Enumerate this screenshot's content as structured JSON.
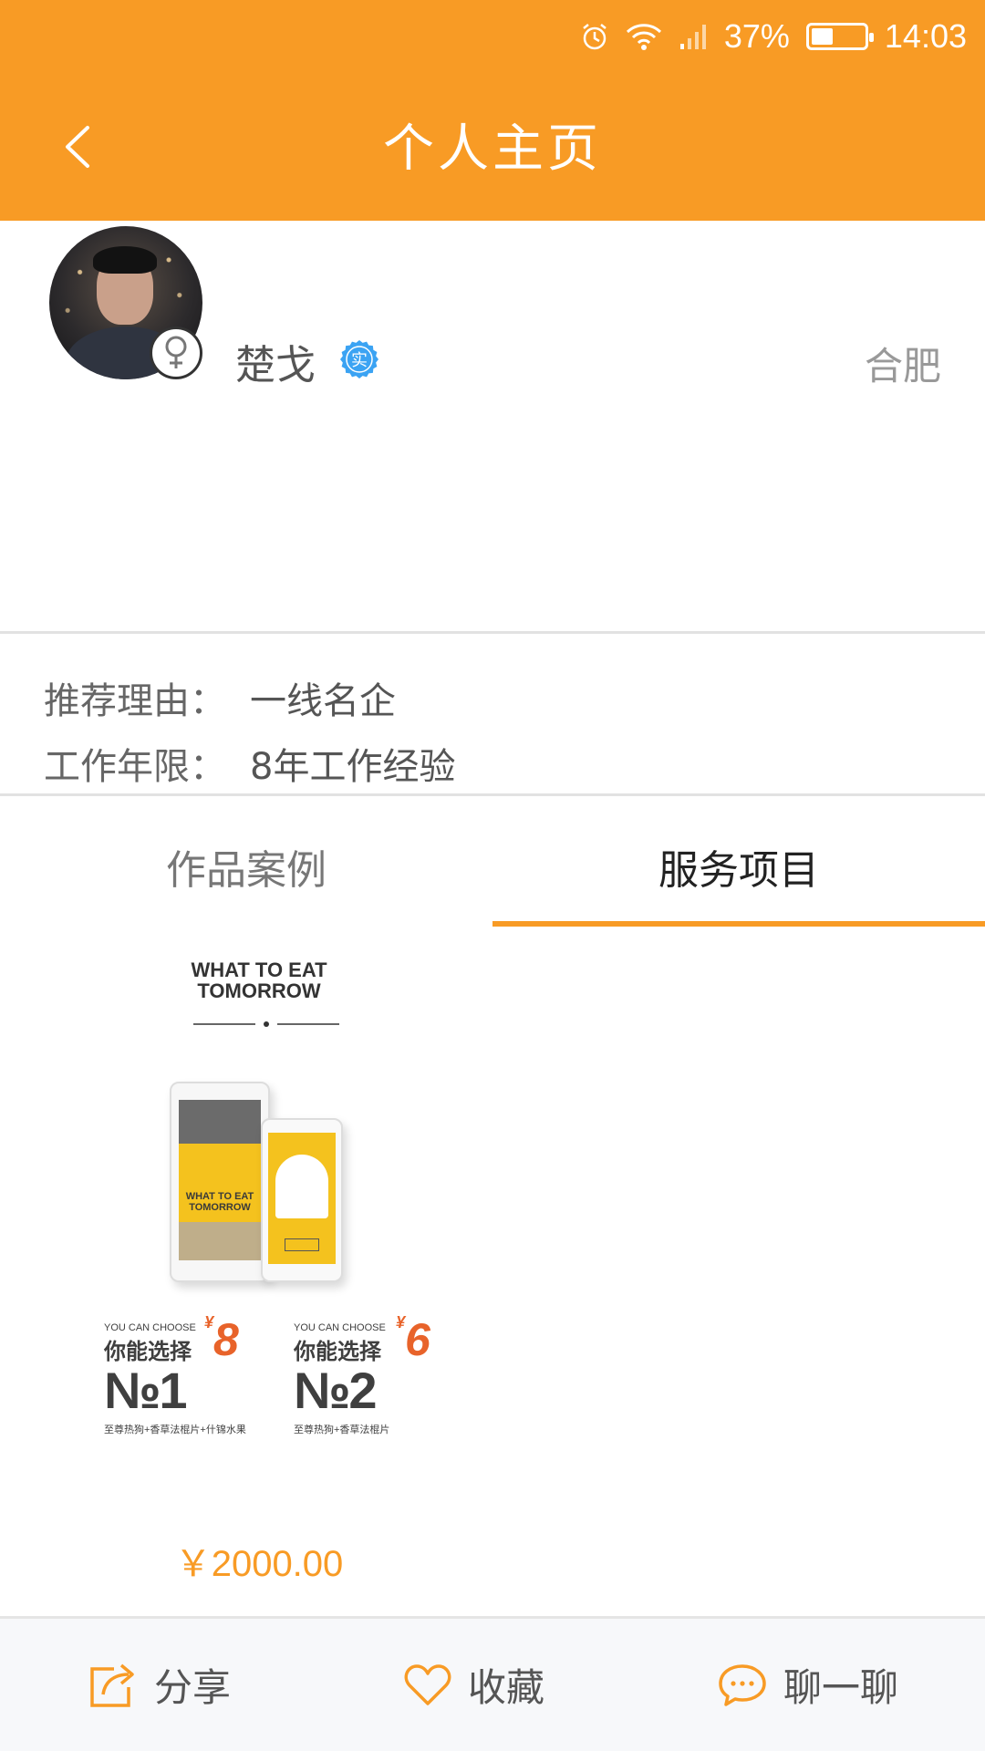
{
  "status_bar": {
    "battery_percent": "37%",
    "battery_level": 0.37,
    "time": "14:03",
    "icons": [
      "alarm-icon",
      "wifi-icon",
      "signal-icon",
      "battery-icon"
    ]
  },
  "header": {
    "title": "个人主页",
    "back_icon": "chevron-left-icon"
  },
  "profile": {
    "name": "楚戈",
    "city": "合肥",
    "gender_icon": "female-symbol-icon",
    "verified_badge_text": "实",
    "verified_badge_color": "#3BA3F3"
  },
  "info": {
    "reason_label": "推荐理由：",
    "reason_value": "一线名企",
    "years_label": "工作年限：",
    "years_value": "8年工作经验"
  },
  "tabs": [
    {
      "label": "作品案例",
      "active": false
    },
    {
      "label": "服务项目",
      "active": true
    }
  ],
  "product": {
    "poster": {
      "title_line1": "WHAT TO EAT",
      "title_line2": "TOMORROW",
      "tablet_title": "WHAT TO EAT TOMORROW",
      "choice1": {
        "small": "YOU CAN CHOOSE",
        "cn": "你能选择",
        "num": "№1",
        "price": "8",
        "yen": "¥",
        "desc": "至尊热狗+香草法棍片+什锦水果"
      },
      "choice2": {
        "small": "YOU CAN CHOOSE",
        "cn": "你能选择",
        "num": "№2",
        "price": "6",
        "yen": "¥",
        "desc": "至尊热狗+香草法棍片"
      }
    },
    "price": "￥2000.00"
  },
  "bottom_bar": {
    "share": "分享",
    "favorite": "收藏",
    "chat": "聊一聊"
  },
  "colors": {
    "accent": "#F89B25",
    "price_orange": "#E8632A"
  }
}
